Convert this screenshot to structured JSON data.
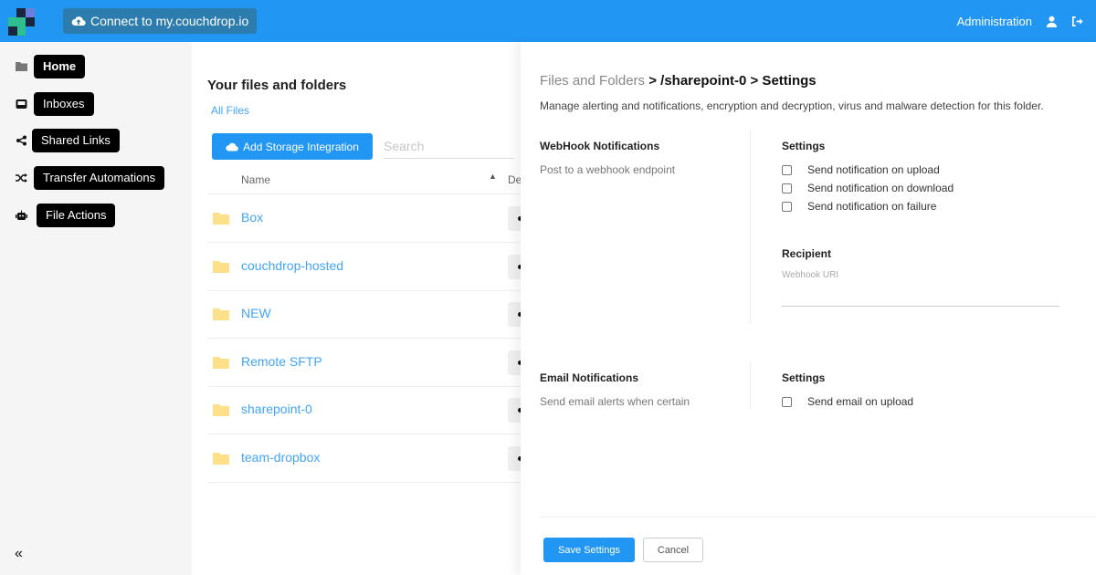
{
  "topbar": {
    "connect_label": "Connect to my.couchdrop.io",
    "admin_label": "Administration",
    "icons": {
      "connect": "cloud-upload-icon",
      "user": "user-icon",
      "logout": "sign-out-icon"
    },
    "color": "#2196f3"
  },
  "sidebar": {
    "items": [
      {
        "label": "Home",
        "icon": "folder-icon",
        "active": true
      },
      {
        "label": "Inboxes",
        "icon": "inbox-icon",
        "active": false
      },
      {
        "label": "Shared Links",
        "icon": "share-icon",
        "active": false
      },
      {
        "label": "Transfer Automations",
        "icon": "shuffle-icon",
        "active": false
      },
      {
        "label": "File Actions",
        "icon": "robot-icon",
        "active": false
      }
    ],
    "collapse_glyph": "«"
  },
  "main": {
    "title": "Your files and folders",
    "breadcrumb": "All Files",
    "add_storage_label": "Add Storage Integration",
    "search_placeholder": "Search",
    "columns": {
      "name": "Name",
      "sort_glyph": "▲",
      "second": "De"
    },
    "files": [
      {
        "name": "Box"
      },
      {
        "name": "couchdrop-hosted"
      },
      {
        "name": "NEW"
      },
      {
        "name": "Remote SFTP"
      },
      {
        "name": "sharepoint-0"
      },
      {
        "name": "team-dropbox"
      }
    ]
  },
  "panel": {
    "breadcrumb_root": "Files and Folders",
    "breadcrumb_rest": " > /sharepoint-0 > Settings",
    "description": "Manage alerting and notifications, encryption and decryption, virus and malware detection for this folder.",
    "webhook": {
      "title": "WebHook Notifications",
      "subtitle": "Post to a webhook endpoint",
      "settings_heading": "Settings",
      "options": [
        {
          "label": "Send notification on upload",
          "checked": false
        },
        {
          "label": "Send notification on download",
          "checked": false
        },
        {
          "label": "Send notification on failure",
          "checked": false
        }
      ],
      "recipient_heading": "Recipient",
      "uri_label": "Webhook URI",
      "uri_value": ""
    },
    "email": {
      "title": "Email Notifications",
      "subtitle": "Send email alerts when certain",
      "settings_heading": "Settings",
      "options": [
        {
          "label": "Send email on upload",
          "checked": false
        }
      ]
    },
    "save_label": "Save Settings",
    "cancel_label": "Cancel"
  }
}
